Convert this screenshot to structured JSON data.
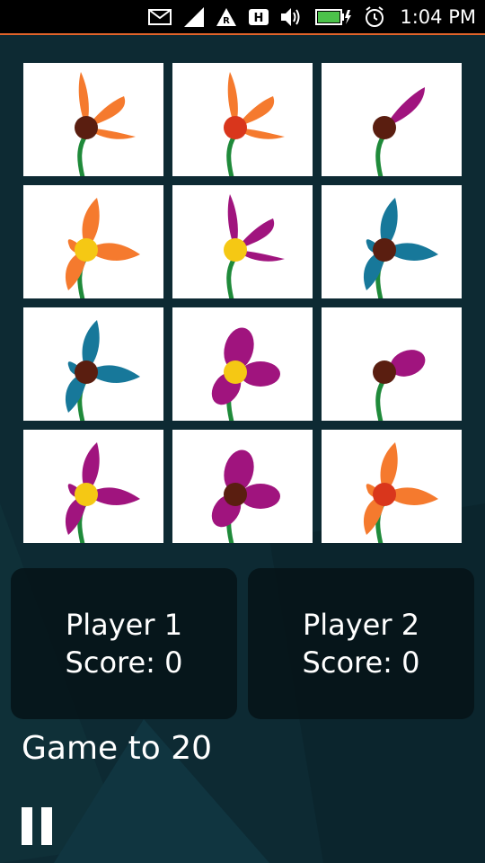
{
  "status_bar": {
    "time": "1:04 PM",
    "icons": [
      "mail-icon",
      "signal-icon",
      "roaming-icon",
      "hspa-icon",
      "volume-icon",
      "battery-charging-icon",
      "alarm-icon"
    ],
    "accent_color": "#e0632a"
  },
  "cards": [
    {
      "petals": "orange",
      "center": "brown",
      "style": "two-petal"
    },
    {
      "petals": "orange",
      "center": "red",
      "style": "two-petal"
    },
    {
      "petals": "magenta",
      "center": "brown",
      "style": "one-petal"
    },
    {
      "petals": "orange",
      "center": "yellow",
      "style": "three-petal"
    },
    {
      "petals": "magenta",
      "center": "yellow",
      "style": "two-petal"
    },
    {
      "petals": "teal",
      "center": "brown",
      "style": "three-petal"
    },
    {
      "petals": "teal",
      "center": "brown",
      "style": "three-petal"
    },
    {
      "petals": "magenta",
      "center": "yellow",
      "style": "round-petal"
    },
    {
      "petals": "magenta",
      "center": "brown",
      "style": "one-round-petal"
    },
    {
      "petals": "magenta",
      "center": "yellow",
      "style": "three-petal"
    },
    {
      "petals": "magenta",
      "center": "brown",
      "style": "round-petal"
    },
    {
      "petals": "orange",
      "center": "red",
      "style": "three-petal"
    }
  ],
  "colors": {
    "orange": "#f57a2e",
    "magenta": "#a0147e",
    "teal": "#17789a",
    "brown": "#5a1e10",
    "red": "#d9361c",
    "yellow": "#f5c814",
    "stem": "#1f8a3a"
  },
  "players": [
    {
      "name": "Player 1",
      "score_label": "Score: 0"
    },
    {
      "name": "Player 2",
      "score_label": "Score: 0"
    }
  ],
  "game_to": "Game to 20"
}
